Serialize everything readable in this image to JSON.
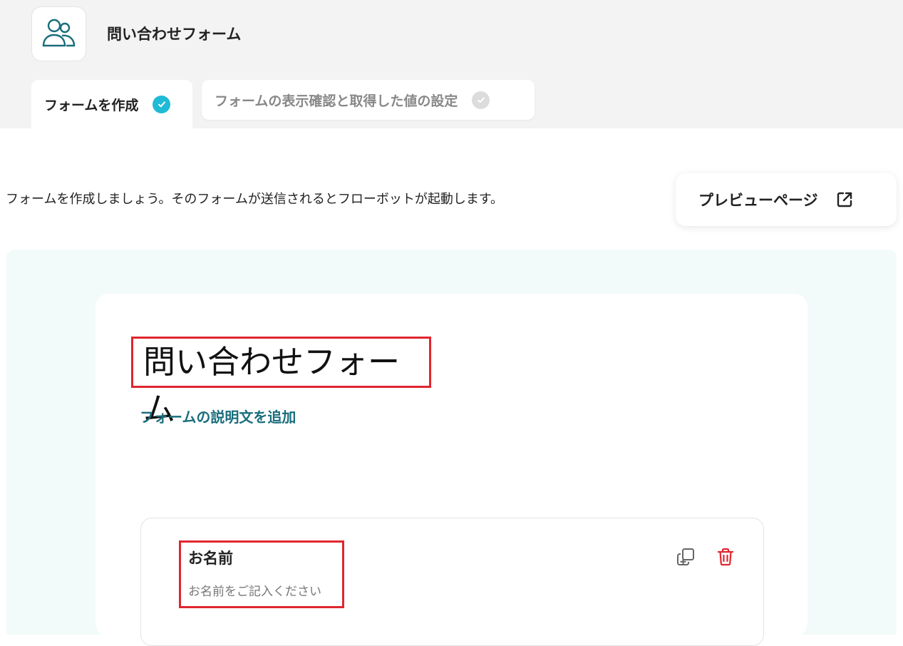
{
  "app": {
    "title": "問い合わせフォーム",
    "icon": "users-icon"
  },
  "tabs": [
    {
      "label": "フォームを作成",
      "status": "complete",
      "active": true
    },
    {
      "label": "フォームの表示確認と取得した値の設定",
      "status": "incomplete",
      "active": false
    }
  ],
  "intro_text": "フォームを作成しましょう。そのフォームが送信されるとフローボットが起動します。",
  "preview_button": {
    "label": "プレビューページ",
    "icon": "external-link-icon"
  },
  "form": {
    "title": "問い合わせフォーム",
    "add_description_label": "フォームの説明文を追加",
    "fields": [
      {
        "label": "お名前",
        "placeholder": "お名前をご記入ください",
        "actions": [
          "duplicate-icon",
          "trash-icon"
        ]
      }
    ]
  },
  "colors": {
    "accent": "#196d7c",
    "check_active": "#1fbad6",
    "highlight_border": "#e0262f",
    "delete": "#e0262f",
    "canvas_bg": "#f2fbfa"
  }
}
